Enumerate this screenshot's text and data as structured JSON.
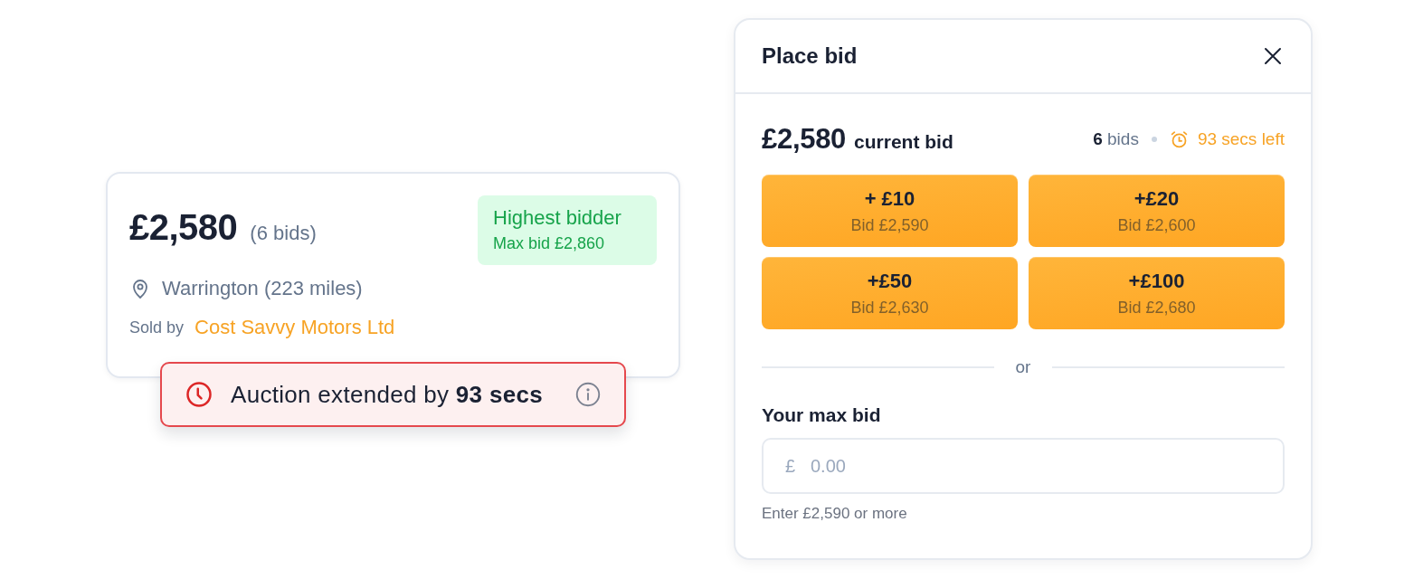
{
  "listing": {
    "price": "£2,580",
    "bids": "(6 bids)",
    "status": {
      "title": "Highest bidder",
      "detail": "Max bid £2,860"
    },
    "location": "Warrington (223 miles)",
    "seller_label": "Sold by",
    "seller": "Cost Savvy Motors Ltd",
    "alert": "Auction extended by **93 secs**"
  },
  "dialog": {
    "title": "Place bid",
    "current_bid": "£2,580",
    "current_bid_label": "current bid",
    "bid_count": "**6** bids",
    "time_left": "93 secs left",
    "quick_bids": [
      {
        "amount": "+ £10",
        "detail": "Bid £2,590"
      },
      {
        "amount": "+£20",
        "detail": "Bid £2,600"
      },
      {
        "amount": "+£50",
        "detail": "Bid £2,630"
      },
      {
        "amount": "+£100",
        "detail": "Bid £2,680"
      }
    ],
    "divider": "or",
    "max_bid": {
      "label": "Your max bid",
      "currency": "£",
      "placeholder": "0.00",
      "hint": "Enter £2,590 or more"
    }
  }
}
